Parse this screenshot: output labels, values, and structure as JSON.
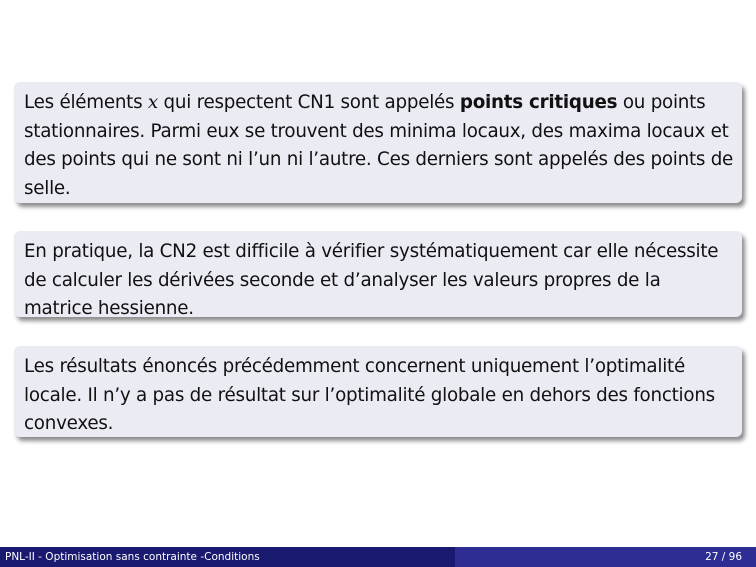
{
  "blocks": [
    {
      "text_before_var": "Les éléments ",
      "variable": "x",
      "text_after_var": " qui respectent CN1 sont appelés ",
      "bold": "points critiques",
      "text_after_bold": " ou points stationnaires. Parmi eux se trouvent des minima locaux, des maxima locaux et des points qui ne sont ni l’un ni l’autre. Ces derniers sont appelés des points de selle."
    },
    {
      "text": "En pratique, la CN2 est difficile à vérifier systématiquement car elle nécessite de calculer les dérivées seconde et d’analyser les valeurs propres de la matrice hessienne."
    },
    {
      "text": "Les résultats énoncés précédemment concernent uniquement l’optimalité locale. Il n’y a pas de résultat sur l’optimalité globale en dehors des fonctions convexes."
    }
  ],
  "footer": {
    "title": "PNL-II - Optimisation sans contrainte -Conditions",
    "page": "27 / 96"
  },
  "colors": {
    "block_background": "#ebebf4",
    "footer_left": "#191970",
    "footer_right": "#2d2d94"
  }
}
